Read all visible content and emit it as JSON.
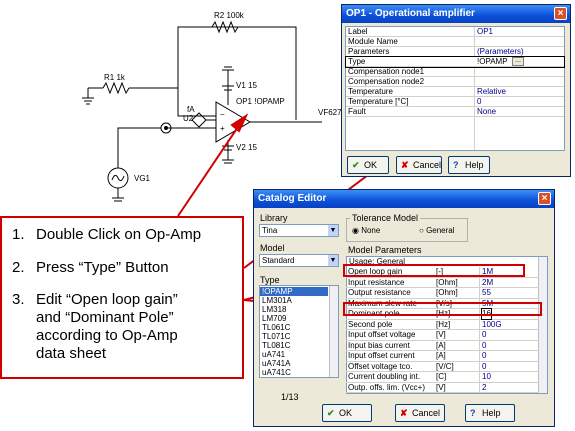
{
  "schematic": {
    "r2_label": "R2 100k",
    "r1_label": "R1 1k",
    "v1_label": "V1 15",
    "v2_label": "V2 15",
    "op_label": "OP1 !OPAMP",
    "u2_label": "U2",
    "fa_label": "fA",
    "out_label": "VF627",
    "vg1_label": "VG1"
  },
  "op_dialog": {
    "title": "OP1 - Operational amplifier",
    "close": "×",
    "rows": [
      {
        "name": "Label",
        "value": "OP1"
      },
      {
        "name": "Module Name",
        "value": ""
      },
      {
        "name": "Parameters",
        "value": "(Parameters)"
      },
      {
        "name": "Type",
        "value": "!OPAMP"
      },
      {
        "name": "Compensation node1",
        "value": ""
      },
      {
        "name": "Compensation node2",
        "value": ""
      },
      {
        "name": "Temperature",
        "value": "Relative"
      },
      {
        "name": "Temperature [°C]",
        "value": "0"
      },
      {
        "name": "Fault",
        "value": "None"
      }
    ],
    "type_button": "...",
    "ok": "OK",
    "cancel": "Cancel",
    "help": "Help"
  },
  "catalog": {
    "title": "Catalog Editor",
    "close": "×",
    "library_label": "Library",
    "library_value": "Tina",
    "model_label": "Model",
    "model_value": "Standard",
    "type_label": "Type",
    "types": [
      "!OPAMP",
      "LM301A",
      "LM318",
      "LM709",
      "TL061C",
      "TL071C",
      "TL081C",
      "uA741",
      "uA741A",
      "uA741C"
    ],
    "page": "1/13",
    "tolerance_title": "Tolerance Model",
    "tol_none": "None",
    "tol_general": "General",
    "model_params_label": "Model Parameters",
    "usage": "Usage: General",
    "params": [
      {
        "name": "Open loop gain",
        "unit": "[-]",
        "value": "1M"
      },
      {
        "name": "Input resistance",
        "unit": "[Ohm]",
        "value": "2M"
      },
      {
        "name": "Output resistance",
        "unit": "[Ohm]",
        "value": "55"
      },
      {
        "name": "Maximum slew rate",
        "unit": "[V/s]",
        "value": "5M"
      },
      {
        "name": "Dominant pole",
        "unit": "[Hz]",
        "value": "16"
      },
      {
        "name": "Second pole",
        "unit": "[Hz]",
        "value": "100G"
      },
      {
        "name": "Input offset voltage",
        "unit": "[V]",
        "value": "0"
      },
      {
        "name": "Input bias current",
        "unit": "[A]",
        "value": "0"
      },
      {
        "name": "Input offset current",
        "unit": "[A]",
        "value": "0"
      },
      {
        "name": "Offset voltage tco.",
        "unit": "[V/C]",
        "value": "0"
      },
      {
        "name": "Current doubling int.",
        "unit": "[C]",
        "value": "10"
      },
      {
        "name": "Outp. offs. lim. (Vcc+)",
        "unit": "[V]",
        "value": "2"
      }
    ],
    "ok": "OK",
    "cancel": "Cancel",
    "help": "Help"
  },
  "instructions": {
    "step1_num": "1.",
    "step1": "Double Click on Op-Amp",
    "step2_num": "2.",
    "step2": "Press “Type” Button",
    "step3_num": "3.",
    "step3_a": "Edit “Open loop gain”",
    "step3_b": "and “Dominant Pole”",
    "step3_c": "according to Op-Amp",
    "step3_d": "data sheet"
  },
  "colors": {
    "accent_red": "#d10000",
    "title_blue": "#0a4fd8",
    "dialog_bg": "#ece9d8"
  }
}
